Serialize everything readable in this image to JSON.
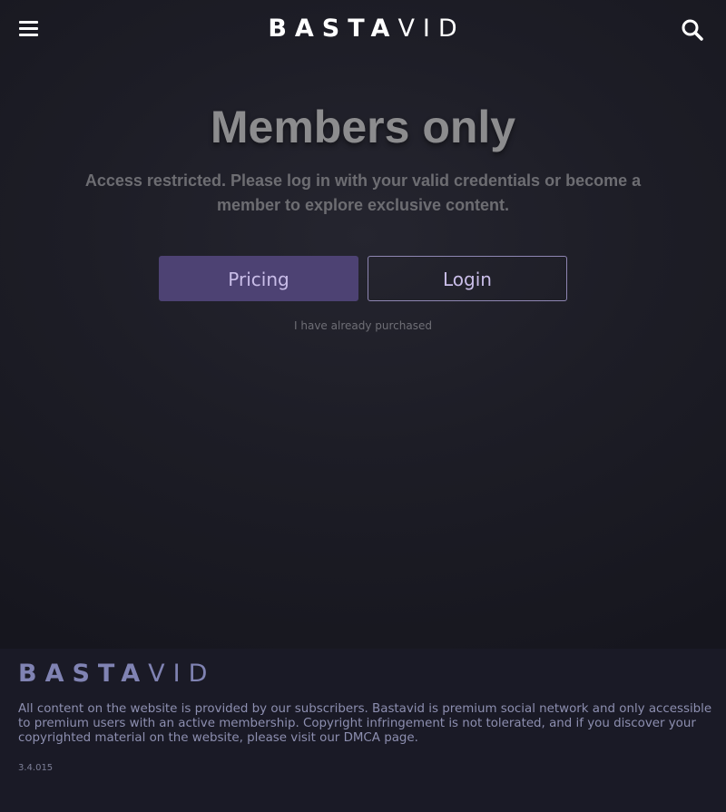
{
  "header": {
    "logo_bold": "BASTA",
    "logo_light": "VID",
    "menu_icon": "hamburger-menu-icon",
    "search_icon": "search-icon"
  },
  "main": {
    "title": "Members only",
    "description": "Access restricted. Please log in with your valid credentials or become a member to explore exclusive content.",
    "pricing_label": "Pricing",
    "login_label": "Login",
    "purchased_link": "I have already purchased"
  },
  "footer": {
    "logo_bold": "BASTA",
    "logo_light": "VID",
    "text": "All content on the website is provided by our subscribers. Bastavid is premium social network and only accessible to premium users with an active membership. Copyright infringement is not tolerated, and if you discover your copyrighted material on the website, please visit our DMCA page.",
    "version": "3.4.015"
  },
  "colors": {
    "background": "#1d1d26",
    "accent": "#4d4273",
    "accent_text": "#c9bde8",
    "footer_bg": "#1a1a26",
    "footer_logo": "#8083b3"
  }
}
